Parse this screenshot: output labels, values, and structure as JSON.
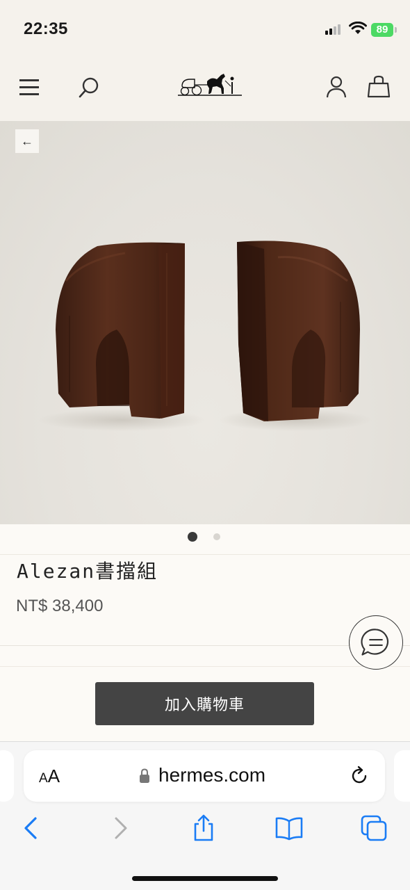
{
  "status_bar": {
    "time": "22:35",
    "battery": "89",
    "icons": [
      "cellular-signal-icon",
      "wifi-icon",
      "battery-charging-icon"
    ]
  },
  "header": {
    "icons": [
      "menu-icon",
      "search-icon",
      "hermes-carriage-logo",
      "account-icon",
      "shopping-bag-icon"
    ]
  },
  "product": {
    "back_label": "←",
    "title": "Alezan書擋組",
    "price": "NT$ 38,400",
    "image_count": 2,
    "active_image": 1
  },
  "cart": {
    "add_to_cart_label": "加入購物車"
  },
  "chat": {
    "icon": "chat-bubble-icon"
  },
  "browser": {
    "text_size_label_small": "A",
    "text_size_label_large": "A",
    "url": "hermes.com",
    "toolbar_icons": [
      "back-icon",
      "forward-icon",
      "share-icon",
      "bookmarks-icon",
      "tabs-icon"
    ]
  },
  "colors": {
    "header_bg": "#f5f2ec",
    "page_bg": "#fcfaf6",
    "button_bg": "#444444",
    "ios_blue": "#1a7cf5",
    "battery_green": "#4cd964"
  }
}
